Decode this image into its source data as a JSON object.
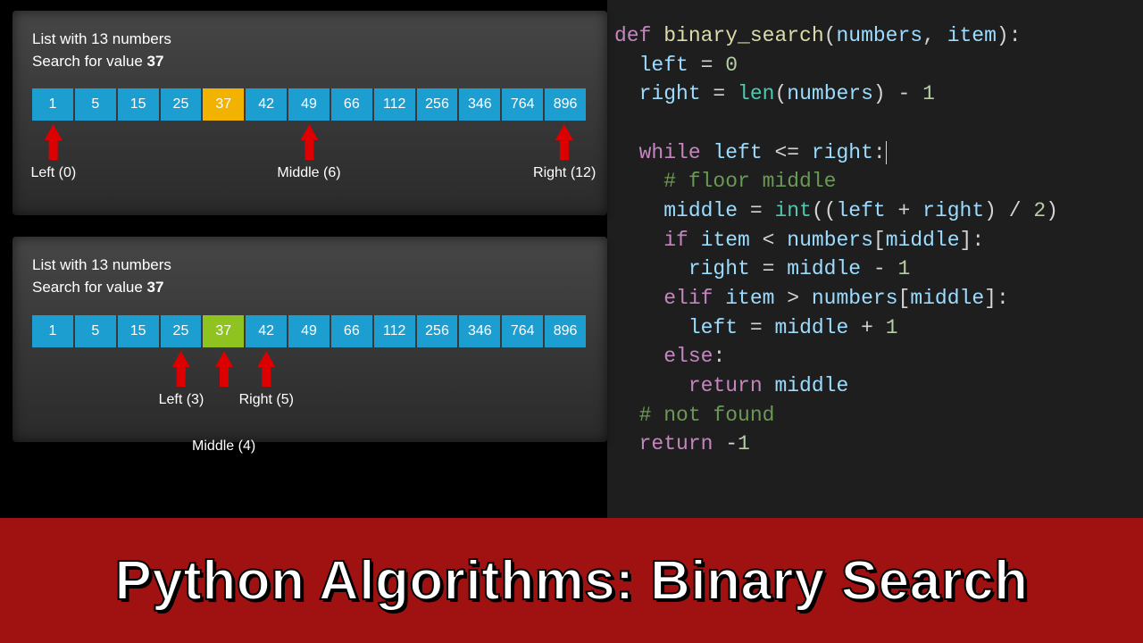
{
  "banner": {
    "title": "Python Algorithms: Binary Search"
  },
  "cells_values": [
    1,
    5,
    15,
    25,
    37,
    42,
    49,
    66,
    112,
    256,
    346,
    764,
    896
  ],
  "panels": [
    {
      "desc_line1": "List with 13 numbers",
      "desc_line2_prefix": "Search for value ",
      "desc_line2_bold": "37",
      "highlight": {
        "index": 4,
        "class": "hilite-yellow"
      },
      "pointers": [
        {
          "slot": 0,
          "label": "Left (0)",
          "lower": false
        },
        {
          "slot": 6,
          "label": "Middle (6)",
          "lower": false
        },
        {
          "slot": 12,
          "label": "Right (12)",
          "lower": false
        }
      ]
    },
    {
      "desc_line1": "List with 13 numbers",
      "desc_line2_prefix": "Search for value ",
      "desc_line2_bold": "37",
      "highlight": {
        "index": 4,
        "class": "hilite-green"
      },
      "pointers": [
        {
          "slot": 3,
          "label": "Left (3)",
          "lower": false
        },
        {
          "slot": 4,
          "label": "Middle (4)",
          "lower": true
        },
        {
          "slot": 5,
          "label": "Right (5)",
          "lower": false
        }
      ]
    }
  ],
  "code": {
    "lines": [
      [
        {
          "t": "def ",
          "c": "tok-kw"
        },
        {
          "t": "binary_search",
          "c": "tok-fn"
        },
        {
          "t": "("
        },
        {
          "t": "numbers",
          "c": "tok-var"
        },
        {
          "t": ", "
        },
        {
          "t": "item",
          "c": "tok-var"
        },
        {
          "t": "):"
        }
      ],
      [
        {
          "t": "  "
        },
        {
          "t": "left",
          "c": "tok-var"
        },
        {
          "t": " = "
        },
        {
          "t": "0",
          "c": "tok-num"
        }
      ],
      [
        {
          "t": "  "
        },
        {
          "t": "right",
          "c": "tok-var"
        },
        {
          "t": " = "
        },
        {
          "t": "len",
          "c": "tok-bi"
        },
        {
          "t": "("
        },
        {
          "t": "numbers",
          "c": "tok-var"
        },
        {
          "t": ") - "
        },
        {
          "t": "1",
          "c": "tok-num"
        }
      ],
      [
        {
          "t": " "
        }
      ],
      [
        {
          "t": "  "
        },
        {
          "t": "while ",
          "c": "tok-kw"
        },
        {
          "t": "left",
          "c": "tok-var"
        },
        {
          "t": " <= "
        },
        {
          "t": "right",
          "c": "tok-var"
        },
        {
          "t": ":",
          "c": "cursor"
        }
      ],
      [
        {
          "t": "    "
        },
        {
          "t": "# floor middle",
          "c": "tok-cmt"
        }
      ],
      [
        {
          "t": "    "
        },
        {
          "t": "middle",
          "c": "tok-var"
        },
        {
          "t": " = "
        },
        {
          "t": "int",
          "c": "tok-bi"
        },
        {
          "t": "(("
        },
        {
          "t": "left",
          "c": "tok-var"
        },
        {
          "t": " + "
        },
        {
          "t": "right",
          "c": "tok-var"
        },
        {
          "t": ") / "
        },
        {
          "t": "2",
          "c": "tok-num"
        },
        {
          "t": ")"
        }
      ],
      [
        {
          "t": "    "
        },
        {
          "t": "if ",
          "c": "tok-kw"
        },
        {
          "t": "item",
          "c": "tok-var"
        },
        {
          "t": " < "
        },
        {
          "t": "numbers",
          "c": "tok-var"
        },
        {
          "t": "["
        },
        {
          "t": "middle",
          "c": "tok-var"
        },
        {
          "t": "]:"
        }
      ],
      [
        {
          "t": "      "
        },
        {
          "t": "right",
          "c": "tok-var"
        },
        {
          "t": " = "
        },
        {
          "t": "middle",
          "c": "tok-var"
        },
        {
          "t": " - "
        },
        {
          "t": "1",
          "c": "tok-num"
        }
      ],
      [
        {
          "t": "    "
        },
        {
          "t": "elif ",
          "c": "tok-kw"
        },
        {
          "t": "item",
          "c": "tok-var"
        },
        {
          "t": " > "
        },
        {
          "t": "numbers",
          "c": "tok-var"
        },
        {
          "t": "["
        },
        {
          "t": "middle",
          "c": "tok-var"
        },
        {
          "t": "]:"
        }
      ],
      [
        {
          "t": "      "
        },
        {
          "t": "left",
          "c": "tok-var"
        },
        {
          "t": " = "
        },
        {
          "t": "middle",
          "c": "tok-var"
        },
        {
          "t": " + "
        },
        {
          "t": "1",
          "c": "tok-num"
        }
      ],
      [
        {
          "t": "    "
        },
        {
          "t": "else",
          "c": "tok-kw"
        },
        {
          "t": ":"
        }
      ],
      [
        {
          "t": "      "
        },
        {
          "t": "return ",
          "c": "tok-kw"
        },
        {
          "t": "middle",
          "c": "tok-var"
        }
      ],
      [
        {
          "t": "  "
        },
        {
          "t": "# not found",
          "c": "tok-cmt"
        }
      ],
      [
        {
          "t": "  "
        },
        {
          "t": "return ",
          "c": "tok-kw"
        },
        {
          "t": "-"
        },
        {
          "t": "1",
          "c": "tok-num"
        }
      ]
    ]
  }
}
